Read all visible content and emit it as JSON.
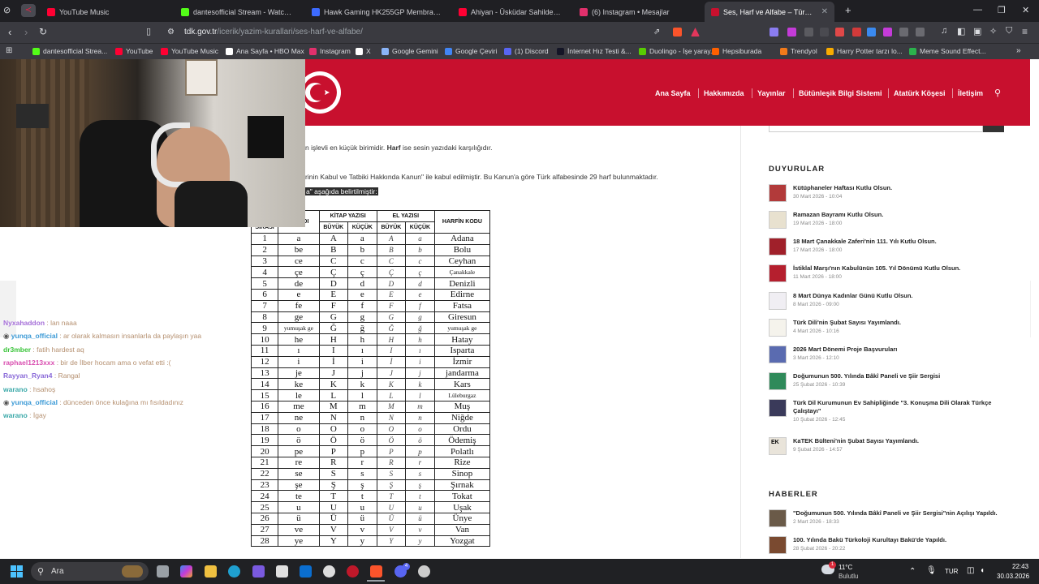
{
  "browser": {
    "tabs": [
      {
        "title": "YouTube Music",
        "color": "#ff0033"
      },
      {
        "title": "dantesofficial Stream - Watch Live on",
        "color": "#53fc18"
      },
      {
        "title": "Hawk Gaming HK255GP Membrane K",
        "color": "#3d6bff"
      },
      {
        "title": "Ahiyan - Üsküdar Sahildeyim (Official",
        "color": "#ff0033"
      },
      {
        "title": "(6) Instagram • Mesajlar",
        "color": "#e1306c"
      },
      {
        "title": "Ses, Harf ve Alfabe – Türk Dil Ku",
        "color": "#c8102e",
        "active": true
      }
    ],
    "new_tab": "+",
    "url_host": "tdk.gov.tr",
    "url_path": "/icerik/yazim-kurallari/ses-harf-ve-alfabe/",
    "bookmarks": [
      {
        "label": "dantesofficial Strea...",
        "color": "#53fc18"
      },
      {
        "label": "YouTube",
        "color": "#ff0033"
      },
      {
        "label": "YouTube Music",
        "color": "#ff0033"
      },
      {
        "label": "Ana Sayfa • HBO Max",
        "color": "#ffffff"
      },
      {
        "label": "Instagram",
        "color": "#e1306c"
      },
      {
        "label": "X",
        "color": "#ffffff"
      },
      {
        "label": "Google Gemini",
        "color": "#8ab4f8"
      },
      {
        "label": "Google Çeviri",
        "color": "#4285f4"
      },
      {
        "label": "(1) Discord",
        "color": "#5865f2"
      },
      {
        "label": "İnternet Hız Testi &...",
        "color": "#141526"
      },
      {
        "label": "Duolingo - İşe yaray...",
        "color": "#58cc02"
      },
      {
        "label": "Hepsiburada",
        "color": "#ff6000"
      },
      {
        "label": "Trendyol",
        "color": "#f27a1a"
      },
      {
        "label": "Harry Potter tarzı lo...",
        "color": "#f9ab00"
      },
      {
        "label": "Meme Sound Effect...",
        "color": "#2bb24c"
      }
    ]
  },
  "site": {
    "nav": [
      "Ana Sayfa",
      "Hakkımızda",
      "Yayınlar",
      "Bütünleşik Bilgi Sistemi",
      "Atatürk Köşesi",
      "İletişim"
    ],
    "intro_line1_pre": "n işlevli en küçük birimidir. ",
    "intro_line1_bold": "Harf",
    "intro_line1_post": " ise sesin yazıdaki karşılığıdır.",
    "intro_line2": "rinin Kabul ve Tatbiki Hakkında Kanun\" ile kabul edilmiştir. Bu Kanun'a göre Türk alfabesinde 29 harf bulunmaktadır.",
    "intro_line3": "a\" aşağıda belirtilmiştir:",
    "table_headers": {
      "order": "SIRASI",
      "name": "FİN ADI",
      "book": "KİTAP YAZISI",
      "hand": "EL YAZISI",
      "code": "HARFİN KODU",
      "upper": "BÜYÜK",
      "lower": "KÜÇÜK"
    },
    "alphabet": [
      [
        "1",
        "a",
        "A",
        "a",
        "A",
        "a",
        "Adana"
      ],
      [
        "2",
        "be",
        "B",
        "b",
        "B",
        "b",
        "Bolu"
      ],
      [
        "3",
        "ce",
        "C",
        "c",
        "C",
        "c",
        "Ceyhan"
      ],
      [
        "4",
        "çe",
        "Ç",
        "ç",
        "Ç",
        "ç",
        "Çanakkale"
      ],
      [
        "5",
        "de",
        "D",
        "d",
        "D",
        "d",
        "Denizli"
      ],
      [
        "6",
        "e",
        "E",
        "e",
        "E",
        "e",
        "Edirne"
      ],
      [
        "7",
        "fe",
        "F",
        "f",
        "F",
        "f",
        "Fatsa"
      ],
      [
        "8",
        "ge",
        "G",
        "g",
        "G",
        "g",
        "Giresun"
      ],
      [
        "9",
        "yumuşak ge",
        "Ğ",
        "ğ",
        "Ğ",
        "ğ",
        "yumuşak ge"
      ],
      [
        "10",
        "he",
        "H",
        "h",
        "H",
        "h",
        "Hatay"
      ],
      [
        "11",
        "ı",
        "I",
        "ı",
        "I",
        "ı",
        "Isparta"
      ],
      [
        "12",
        "i",
        "İ",
        "i",
        "İ",
        "i",
        "İzmir"
      ],
      [
        "13",
        "je",
        "J",
        "j",
        "J",
        "j",
        "jandarma"
      ],
      [
        "14",
        "ke",
        "K",
        "k",
        "K",
        "k",
        "Kars"
      ],
      [
        "15",
        "le",
        "L",
        "l",
        "L",
        "l",
        "Lüleburgaz"
      ],
      [
        "16",
        "me",
        "M",
        "m",
        "M",
        "m",
        "Muş"
      ],
      [
        "17",
        "ne",
        "N",
        "n",
        "N",
        "n",
        "Niğde"
      ],
      [
        "18",
        "o",
        "O",
        "o",
        "O",
        "o",
        "Ordu"
      ],
      [
        "19",
        "ö",
        "Ö",
        "ö",
        "Ö",
        "ö",
        "Ödemiş"
      ],
      [
        "20",
        "pe",
        "P",
        "p",
        "P",
        "p",
        "Polatlı"
      ],
      [
        "21",
        "re",
        "R",
        "r",
        "R",
        "r",
        "Rize"
      ],
      [
        "22",
        "se",
        "S",
        "s",
        "S",
        "s",
        "Sinop"
      ],
      [
        "23",
        "şe",
        "Ş",
        "ş",
        "Ş",
        "ş",
        "Şırnak"
      ],
      [
        "24",
        "te",
        "T",
        "t",
        "T",
        "t",
        "Tokat"
      ],
      [
        "25",
        "u",
        "U",
        "u",
        "U",
        "u",
        "Uşak"
      ],
      [
        "26",
        "ü",
        "Ü",
        "ü",
        "Ü",
        "ü",
        "Ünye"
      ],
      [
        "27",
        "ve",
        "V",
        "v",
        "V",
        "v",
        "Van"
      ],
      [
        "28",
        "ye",
        "Y",
        "y",
        "Y",
        "y",
        "Yozgat"
      ]
    ],
    "announcements_title": "DUYURULAR",
    "announcements": [
      {
        "title": "Kütüphaneler Haftası Kutlu Olsun.",
        "date": "30 Mart 2026 - 10:04",
        "color": "#b23a3a"
      },
      {
        "title": "Ramazan Bayramı Kutlu Olsun.",
        "date": "19 Mart 2026 - 18:00",
        "color": "#e8e1cf"
      },
      {
        "title": "18 Mart Çanakkale Zaferi'nin 111. Yılı Kutlu Olsun.",
        "date": "17 Mart 2026 - 18:00",
        "color": "#a0202a"
      },
      {
        "title": "İstiklal Marşı'nın Kabulünün 105. Yıl Dönümü Kutlu Olsun.",
        "date": "11 Mart 2026 - 18:00",
        "color": "#b51f2e"
      },
      {
        "title": "8 Mart Dünya Kadınlar Günü Kutlu Olsun.",
        "date": "8 Mart 2026 - 09:00",
        "color": "#f0eef3"
      },
      {
        "title": "Türk Dili'nin Şubat Sayısı Yayımlandı.",
        "date": "4 Mart 2026 - 10:16",
        "color": "#f5f3ec"
      },
      {
        "title": "2026 Mart Dönemi Proje Başvuruları",
        "date": "3 Mart 2026 - 12:10",
        "color": "#5a6bb0"
      },
      {
        "title": "Doğumunun 500. Yılında Bâkî Paneli ve Şiir Sergisi",
        "date": "25 Şubat 2026 - 10:39",
        "color": "#2f8a5a"
      },
      {
        "title": "Türk Dil Kurumunun Ev Sahipliğinde \"3. Konuşma Dili Olarak Türkçe Çalıştayı\"",
        "date": "10 Şubat 2026 - 12:45",
        "color": "#3a3a5a"
      },
      {
        "title": "KaTEK Bülteni'nin Şubat Sayısı Yayımlandı.",
        "date": "9 Şubat 2026 - 14:57",
        "color": "#e9e4da",
        "thumb_text": "EK"
      }
    ],
    "news_title": "HABERLER",
    "news": [
      {
        "title": "\"Doğumunun 500. Yılında Bâkî Paneli ve Şiir Sergisi\"nin Açılışı Yapıldı.",
        "date": "2 Mart 2026 - 18:33",
        "color": "#6a5a48"
      },
      {
        "title": "100. Yılında Bakü Türkoloji Kurultayı Bakü'de Yapıldı.",
        "date": "28 Şubat 2026 - 20:22",
        "color": "#7a4a30"
      }
    ]
  },
  "overlay": {
    "chat": [
      {
        "user": "Nyxahaddon",
        "msg": " : lan naaa",
        "color": "#a56fd8"
      },
      {
        "user": "yunqa_official",
        "msg": " : ar olarak kalmasın insanlarla da paylaşın yaa",
        "color": "#3c9ad6",
        "badge": true
      },
      {
        "user": "dr3mber",
        "msg": " : fatih hardest aq",
        "color": "#3ac43a"
      },
      {
        "user": "raphael1213xxx",
        "msg": " : bir de İlber hocam ama o vefat etti :(",
        "color": "#d94fb0"
      },
      {
        "user": "Rayyan_Ryan4",
        "msg": " : Rangal",
        "color": "#8a6ad8"
      },
      {
        "user": "warano",
        "msg": " : hsahoş",
        "color": "#3aa8a8"
      },
      {
        "user": "yunqa_official",
        "msg": " : dünceden önce kulağına mı fısıldadınız",
        "color": "#3c9ad6",
        "badge": true
      },
      {
        "user": "warano",
        "msg": " : İgay",
        "color": "#3aa8a8"
      }
    ]
  },
  "taskbar": {
    "search_placeholder": "Ara",
    "weather_temp": "11°C",
    "weather_desc": "Bulutlu",
    "weather_badge": "1",
    "lang": "TUR",
    "time": "22:43",
    "date": "30.03.2026",
    "discord_badge": "4"
  }
}
